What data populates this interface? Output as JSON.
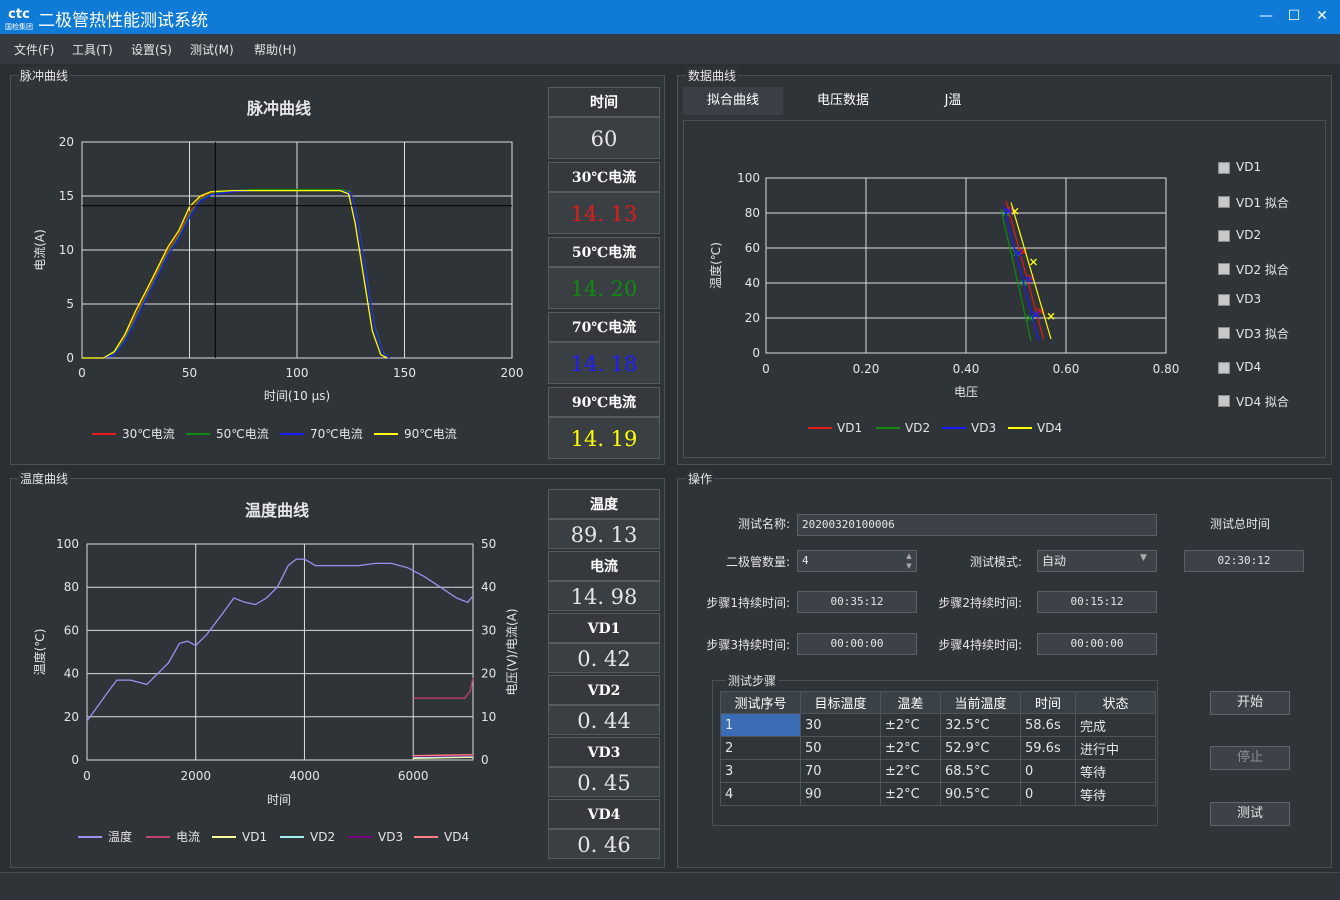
{
  "window": {
    "title": "二极管热性能测试系统",
    "logo_text": "国检集团",
    "logo_mark": "ctc",
    "controls": {
      "minimize": "—",
      "maximize": "☐",
      "close": "✕"
    }
  },
  "menu": [
    "文件(F)",
    "工具(T)",
    "设置(S)",
    "测试(M)",
    "帮助(H)"
  ],
  "pulse_group": {
    "label": "脉冲曲线",
    "panels": [
      {
        "header": "时间",
        "value": "60",
        "color": "#e6e6e6"
      },
      {
        "header": "30℃电流",
        "value": "14. 13",
        "color": "#e31b1b"
      },
      {
        "header": "50℃电流",
        "value": "14. 20",
        "color": "#118a11"
      },
      {
        "header": "70℃电流",
        "value": "14. 18",
        "color": "#1b1bff"
      },
      {
        "header": "90℃电流",
        "value": "14. 19",
        "color": "#ffff00"
      }
    ]
  },
  "data_group": {
    "label": "数据曲线",
    "tabs": [
      "拟合曲线",
      "电压数据",
      "J温"
    ],
    "active_tab": 0,
    "checkboxes": [
      "VD1",
      "VD1 拟合",
      "VD2",
      "VD2 拟合",
      "VD3",
      "VD3 拟合",
      "VD4",
      "VD4 拟合"
    ]
  },
  "temp_group": {
    "label": "温度曲线",
    "panels": [
      {
        "header": "温度",
        "value": "89. 13"
      },
      {
        "header": "电流",
        "value": "14. 98"
      },
      {
        "header": "VD1",
        "value": "0. 42"
      },
      {
        "header": "VD2",
        "value": "0. 44"
      },
      {
        "header": "VD3",
        "value": "0. 45"
      },
      {
        "header": "VD4",
        "value": "0. 46"
      }
    ]
  },
  "operation": {
    "label": "操作",
    "test_name_label": "测试名称:",
    "test_name_value": "20200320100006",
    "total_time_label": "测试总时间",
    "total_time_value": "02:30:12",
    "diode_count_label": "二极管数量:",
    "diode_count_value": "4",
    "mode_label": "测试模式:",
    "mode_value": "自动",
    "step1_label": "步骤1持续时间:",
    "step1_value": "00:35:12",
    "step2_label": "步骤2持续时间:",
    "step2_value": "00:15:12",
    "step3_label": "步骤3持续时间:",
    "step3_value": "00:00:00",
    "step4_label": "步骤4持续时间:",
    "step4_value": "00:00:00",
    "steps_group_label": "测试步骤",
    "steps_headers": [
      "测试序号",
      "目标温度",
      "温差",
      "当前温度",
      "时间",
      "状态"
    ],
    "steps_rows": [
      [
        "1",
        "30",
        "±2°C",
        "32.5°C",
        "58.6s",
        "完成"
      ],
      [
        "2",
        "50",
        "±2°C",
        "52.9°C",
        "59.6s",
        "进行中"
      ],
      [
        "3",
        "70",
        "±2°C",
        "68.5°C",
        "0",
        "等待"
      ],
      [
        "4",
        "90",
        "±2°C",
        "90.5°C",
        "0",
        "等待"
      ]
    ],
    "buttons": {
      "start": "开始",
      "stop": "停止",
      "test": "测试"
    }
  },
  "chart_data": [
    {
      "type": "line",
      "title": "脉冲曲线",
      "xlabel": "时间(10 μs)",
      "ylabel": "电流(A)",
      "xlim": [
        0,
        200
      ],
      "ylim": [
        0,
        20
      ],
      "xticks": [
        0,
        50,
        100,
        150,
        200
      ],
      "yticks": [
        0,
        5,
        10,
        15,
        20
      ],
      "grid": true,
      "legend": "bottom",
      "cursor": {
        "x": 62,
        "y": 14.1
      },
      "series": [
        {
          "name": "30℃电流",
          "color": "#e31b1b",
          "x": [
            0,
            10,
            15,
            20,
            25,
            30,
            35,
            40,
            45,
            50,
            55,
            60,
            70,
            80,
            100,
            120,
            125,
            128,
            132,
            136,
            140,
            143
          ],
          "y": [
            0,
            0,
            0.5,
            2,
            4,
            6,
            8,
            10,
            11.5,
            13.5,
            14.8,
            15.3,
            15.5,
            15.6,
            15.6,
            15.6,
            15.4,
            13,
            8,
            3,
            0.5,
            0
          ]
        },
        {
          "name": "50℃电流",
          "color": "#118a11",
          "x": [
            0,
            10,
            15,
            20,
            25,
            30,
            35,
            40,
            45,
            50,
            55,
            60,
            70,
            80,
            100,
            120,
            125,
            128,
            132,
            136,
            140,
            143
          ],
          "y": [
            0,
            0,
            0.4,
            1.8,
            3.8,
            5.8,
            7.8,
            9.8,
            11.3,
            13.3,
            14.7,
            15.2,
            15.5,
            15.6,
            15.6,
            15.6,
            15.4,
            13,
            8,
            3,
            0.5,
            0
          ]
        },
        {
          "name": "70℃电流",
          "color": "#1b1bff",
          "x": [
            0,
            10,
            15,
            20,
            25,
            30,
            35,
            40,
            45,
            50,
            55,
            60,
            70,
            80,
            100,
            120,
            125,
            128,
            132,
            136,
            140,
            143
          ],
          "y": [
            0,
            0,
            0.3,
            1.5,
            3.5,
            5.5,
            7.5,
            9.5,
            11.0,
            13.0,
            14.5,
            15.1,
            15.4,
            15.5,
            15.5,
            15.5,
            15.3,
            12.8,
            7.8,
            2.8,
            0.4,
            0
          ]
        },
        {
          "name": "90℃电流",
          "color": "#ffff00",
          "x": [
            0,
            10,
            15,
            20,
            25,
            30,
            35,
            40,
            45,
            50,
            55,
            60,
            70,
            80,
            100,
            120,
            124,
            127,
            131,
            135,
            139,
            142
          ],
          "y": [
            0,
            0,
            0.6,
            2.2,
            4.4,
            6.3,
            8.3,
            10.3,
            11.8,
            14.0,
            15.0,
            15.4,
            15.5,
            15.5,
            15.5,
            15.5,
            15.2,
            12.5,
            7.5,
            2.5,
            0.3,
            0
          ]
        }
      ]
    },
    {
      "type": "line",
      "title": "",
      "xlabel": "电压",
      "ylabel": "温度(℃)",
      "xlim": [
        0,
        0.8
      ],
      "ylim": [
        0,
        100
      ],
      "xticks": [
        "0",
        "0.20",
        "0.40",
        "0.60",
        "0.80"
      ],
      "yticks": [
        0,
        20,
        40,
        60,
        80,
        100
      ],
      "grid": true,
      "legend": "bottom",
      "series": [
        {
          "name": "VD1",
          "color": "#e31b1b",
          "line": [
            [
              0.48,
              87
            ],
            [
              0.555,
              8
            ]
          ],
          "points": [
            [
              0.49,
              82
            ],
            [
              0.515,
              58
            ],
            [
              0.53,
              43
            ],
            [
              0.548,
              24
            ]
          ]
        },
        {
          "name": "VD2",
          "color": "#118a11",
          "line": [
            [
              0.47,
              82
            ],
            [
              0.53,
              7
            ]
          ],
          "points": [
            [
              0.48,
              80
            ],
            [
              0.5,
              57
            ],
            [
              0.515,
              40
            ],
            [
              0.528,
              20
            ]
          ]
        },
        {
          "name": "VD3",
          "color": "#1b1bff",
          "line": [
            [
              0.475,
              84
            ],
            [
              0.545,
              7
            ]
          ],
          "points": [
            [
              0.485,
              81
            ],
            [
              0.505,
              57
            ],
            [
              0.525,
              42
            ],
            [
              0.54,
              22
            ]
          ]
        },
        {
          "name": "VD4",
          "color": "#ffff00",
          "line": [
            [
              0.49,
              86
            ],
            [
              0.57,
              8
            ]
          ],
          "points": [
            [
              0.498,
              81
            ],
            [
              0.535,
              52
            ],
            [
              0.57,
              21
            ]
          ]
        }
      ]
    },
    {
      "type": "line",
      "title": "温度曲线",
      "xlabel": "时间",
      "ylabel": "温度(℃)",
      "y2label": "电压(V)/电流(A)",
      "xlim": [
        0,
        7100
      ],
      "ylim": [
        0,
        100
      ],
      "y2lim": [
        0,
        50
      ],
      "xticks": [
        0,
        2000,
        4000,
        6000
      ],
      "yticks": [
        0,
        20,
        40,
        60,
        80,
        100
      ],
      "y2ticks": [
        0,
        10,
        20,
        30,
        40,
        50
      ],
      "grid": true,
      "legend": "bottom",
      "series": [
        {
          "name": "温度",
          "color": "#9d8ff0",
          "axis": "left",
          "x": [
            0,
            200,
            400,
            550,
            800,
            1100,
            1300,
            1500,
            1700,
            1850,
            2000,
            2200,
            2500,
            2700,
            2900,
            3100,
            3300,
            3500,
            3700,
            3850,
            4000,
            4200,
            4400,
            4700,
            5000,
            5300,
            5600,
            5900,
            6200,
            6500,
            6800,
            7000,
            7100
          ],
          "y": [
            18,
            25,
            32,
            37,
            37,
            35,
            40,
            45,
            54,
            55,
            53,
            58,
            68,
            75,
            73,
            72,
            75,
            80,
            90,
            93,
            93,
            90,
            90,
            90,
            90,
            91,
            91,
            89,
            85,
            80,
            75,
            73,
            76
          ]
        },
        {
          "name": "电流",
          "color": "#c04070",
          "axis": "right",
          "x": [
            6000,
            6100,
            6500,
            6950,
            7050,
            7100
          ],
          "y": [
            14.3,
            14.3,
            14.3,
            14.3,
            16,
            19
          ]
        },
        {
          "name": "VD1",
          "color": "#ffff99",
          "axis": "right",
          "x": [
            6000,
            6500,
            7000,
            7100
          ],
          "y": [
            0.4,
            0.5,
            0.6,
            0.6
          ]
        },
        {
          "name": "VD2",
          "color": "#a0f0f0",
          "axis": "right",
          "x": [
            6000,
            6500,
            7000,
            7100
          ],
          "y": [
            0.6,
            0.7,
            0.8,
            0.8
          ]
        },
        {
          "name": "VD3",
          "color": "#800080",
          "axis": "right",
          "x": [
            6000,
            6500,
            7000,
            7100
          ],
          "y": [
            0.8,
            0.9,
            1.0,
            1.0
          ]
        },
        {
          "name": "VD4",
          "color": "#ff8080",
          "axis": "right",
          "x": [
            6000,
            6500,
            7000,
            7100
          ],
          "y": [
            1.0,
            1.1,
            1.2,
            1.2
          ]
        }
      ]
    }
  ]
}
